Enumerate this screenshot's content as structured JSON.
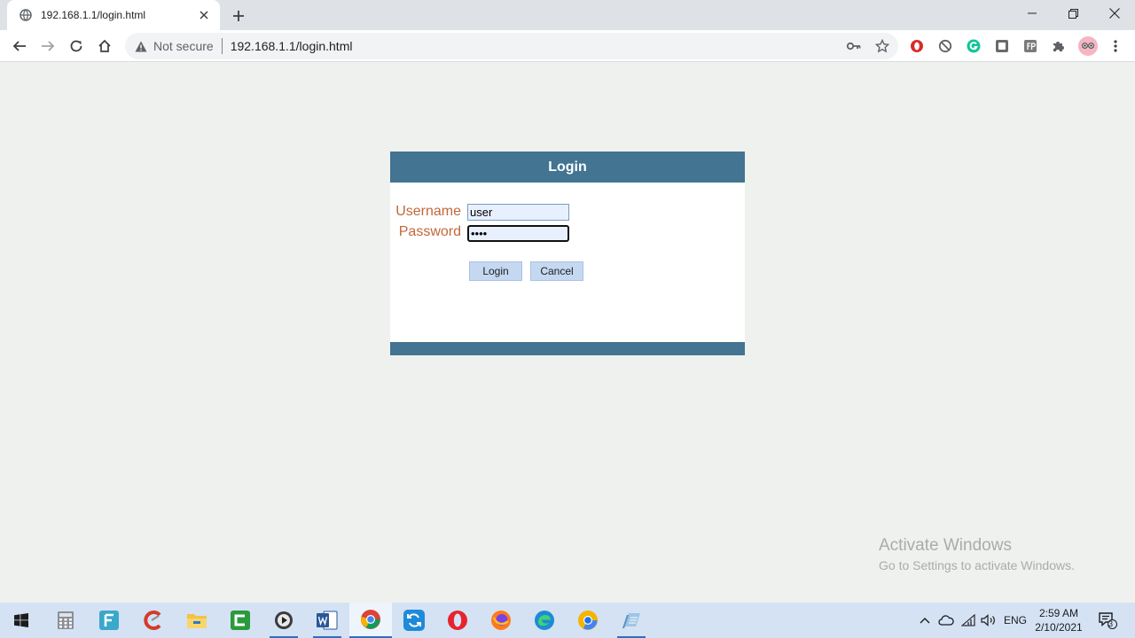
{
  "browser": {
    "tab_title": "192.168.1.1/login.html",
    "security_label": "Not secure",
    "url": "192.168.1.1/login.html"
  },
  "icons": {
    "tab_favicon": "globe-icon",
    "tab_close": "close-icon",
    "new_tab": "plus-icon",
    "back": "arrow-left-icon",
    "forward": "arrow-right-icon",
    "reload": "reload-icon",
    "home": "home-icon",
    "security": "warning-triangle-icon",
    "key": "key-icon",
    "bookmark": "star-icon",
    "extensions": [
      "opera-ext-icon",
      "block-icon",
      "grammarly-icon",
      "ext-box-icon",
      "ext-fb-icon",
      "puzzle-icon",
      "profile-avatar",
      "menu-dots-icon"
    ]
  },
  "login": {
    "title": "Login",
    "username_label": "Username",
    "username_value": "user",
    "password_label": "Password",
    "password_value": "••••",
    "login_button": "Login",
    "cancel_button": "Cancel"
  },
  "watermark": {
    "title": "Activate Windows",
    "subtitle": "Go to Settings to activate Windows."
  },
  "taskbar": {
    "language": "ENG",
    "time": "2:59 AM",
    "date": "2/10/2021",
    "notification_count": "3"
  },
  "colors": {
    "header": "#437491",
    "label": "#c1683a",
    "button": "#c4d8f1"
  }
}
